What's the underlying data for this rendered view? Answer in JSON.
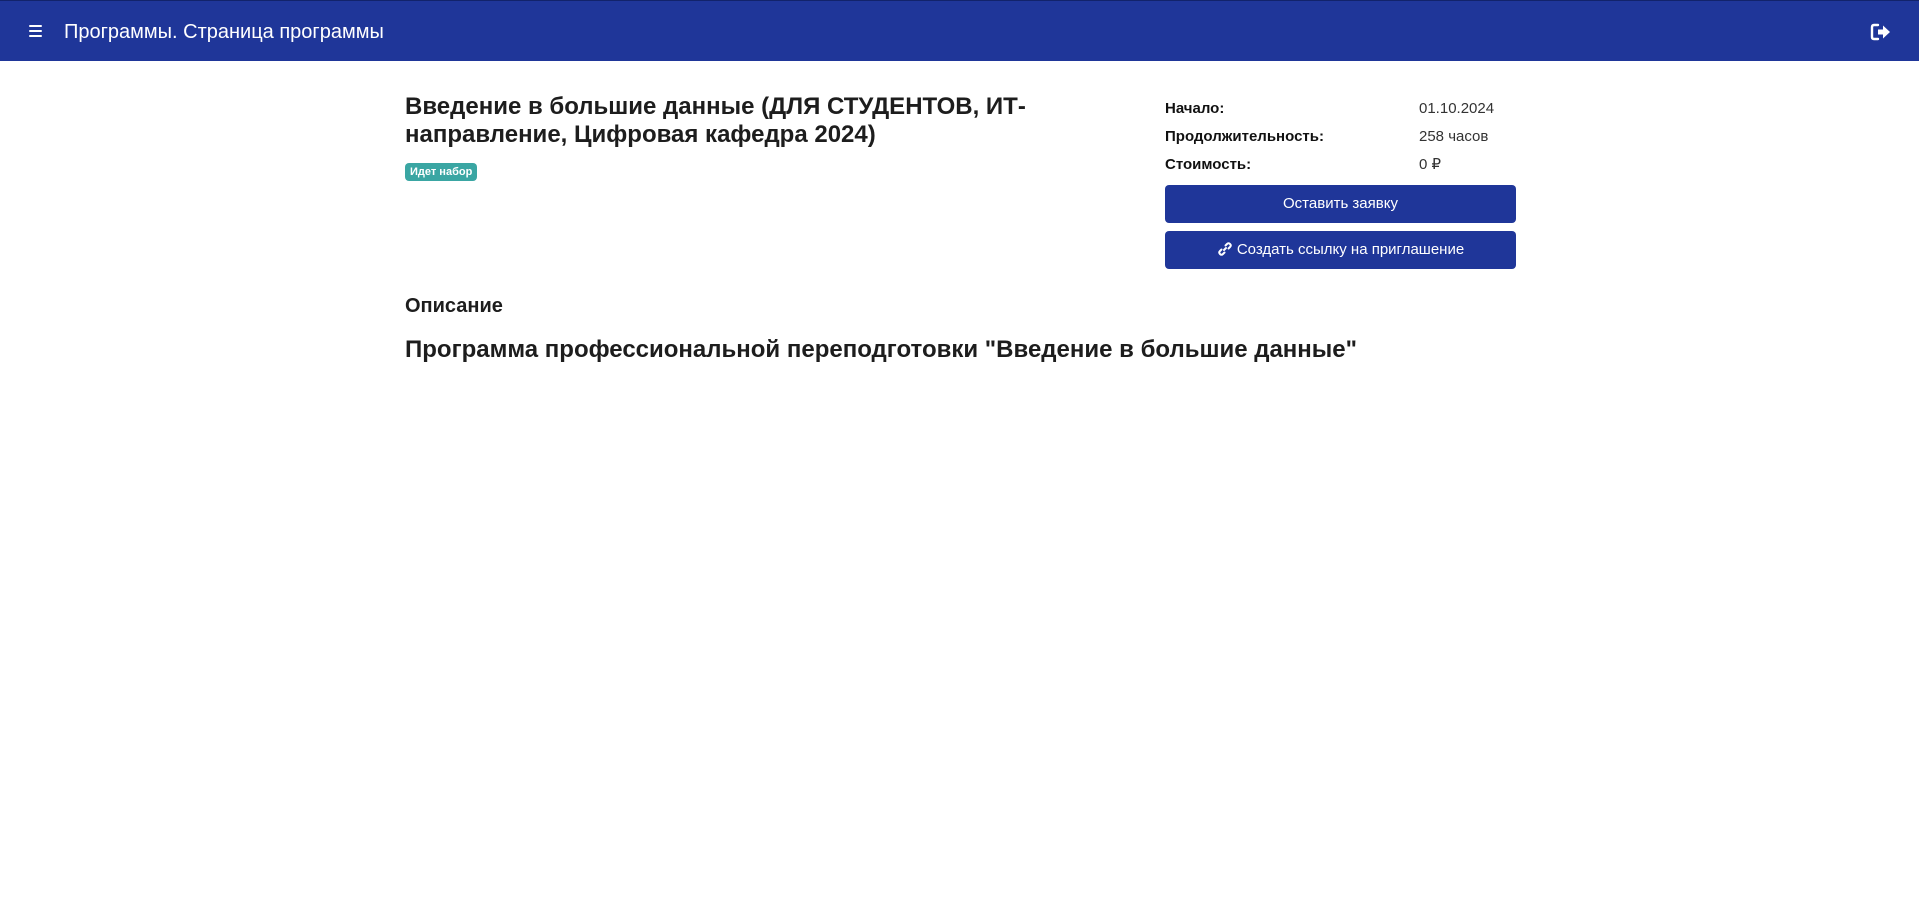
{
  "header": {
    "title": "Программы. Страница программы",
    "menu_icon": "hamburger-icon",
    "logout_icon": "sign-out-icon",
    "background_color": "#1f3699"
  },
  "program": {
    "title": "Введение в большие данные (ДЛЯ СТУДЕНТОВ, ИТ-направление, Цифровая кафедра 2024)",
    "status": "Идет набор",
    "status_color": "#3aa6a3"
  },
  "info": [
    {
      "label": "Начало:",
      "value": "01.10.2024"
    },
    {
      "label": "Продолжительность:",
      "value": "258 часов"
    },
    {
      "label": "Стоимость:",
      "value": "0 ₽"
    }
  ],
  "actions": {
    "apply_label": "Оставить заявку",
    "invite_label": "Создать ссылку на приглашение",
    "invite_icon": "link-icon",
    "button_color": "#1f3699"
  },
  "description": {
    "section_title": "Описание",
    "heading": "Программа профессиональной переподготовки \"Введение в большие данные\""
  }
}
